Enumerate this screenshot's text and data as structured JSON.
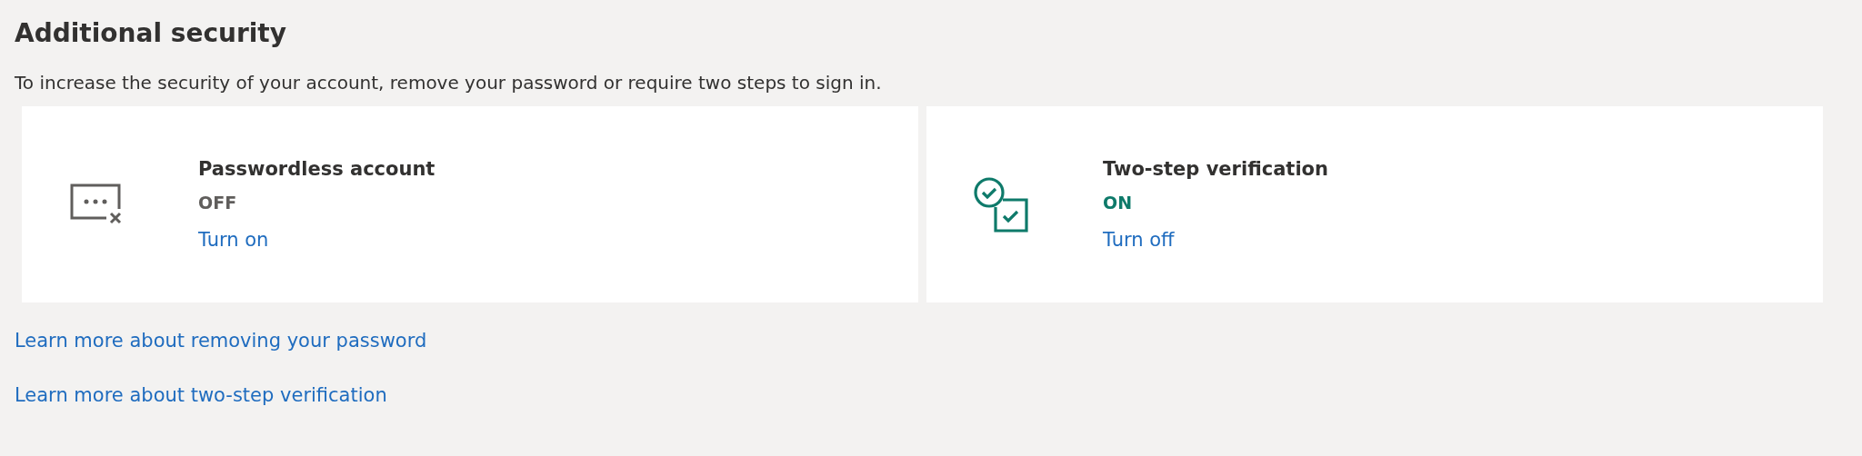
{
  "heading": "Additional security",
  "description": "To increase the security of your account, remove your password or require two steps to sign in.",
  "cards": [
    {
      "kind": "passwordless",
      "title": "Passwordless account",
      "status": "OFF",
      "on": false,
      "action": "Turn on"
    },
    {
      "kind": "twostep",
      "title": "Two-step verification",
      "status": "ON",
      "on": true,
      "action": "Turn off"
    }
  ],
  "links": [
    "Learn more about removing your password",
    "Learn more about two-step verification"
  ]
}
